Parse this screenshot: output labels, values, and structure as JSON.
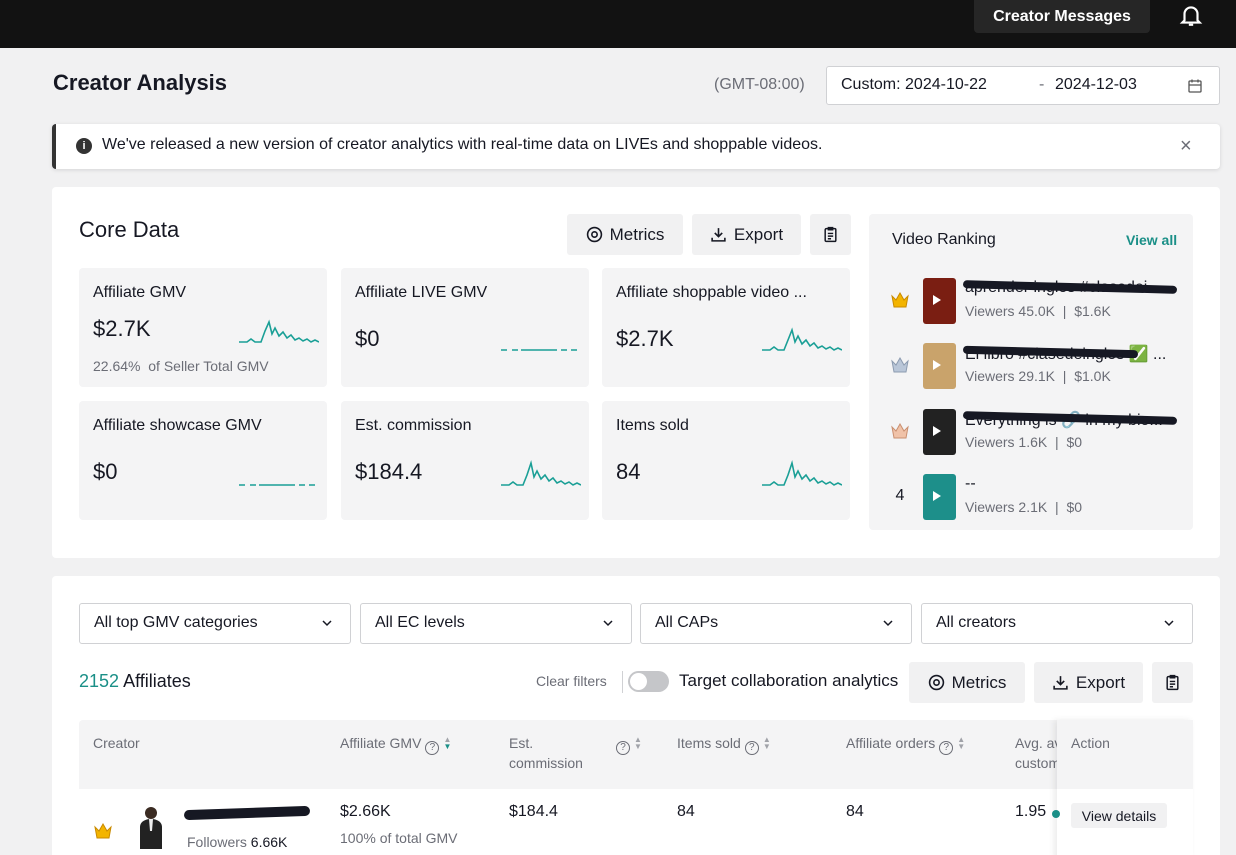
{
  "topbar": {
    "creator_messages": "Creator Messages"
  },
  "header": {
    "title": "Creator Analysis",
    "timezone": "(GMT-08:00)",
    "date_start": "Custom: 2024-10-22",
    "date_sep": "-",
    "date_end": "2024-12-03"
  },
  "banner": {
    "message": "We've released a new version of creator analytics with real-time data on LIVEs and shoppable videos.",
    "close": "×"
  },
  "core": {
    "title": "Core Data",
    "metrics_label": "Metrics",
    "export_label": "Export",
    "cards": [
      {
        "label": "Affiliate GMV",
        "value": "$2.7K",
        "sub_pct": "22.64%",
        "sub_text": "of Seller Total GMV",
        "trend": "spark"
      },
      {
        "label": "Affiliate LIVE GMV",
        "value": "$0",
        "trend": "flat"
      },
      {
        "label": "Affiliate shoppable video ...",
        "value": "$2.7K",
        "trend": "spark"
      },
      {
        "label": "Affiliate showcase GMV",
        "value": "$0",
        "trend": "flat"
      },
      {
        "label": "Est. commission",
        "value": "$184.4",
        "trend": "spark"
      },
      {
        "label": "Items sold",
        "value": "84",
        "trend": "spark"
      }
    ]
  },
  "video_ranking": {
    "title": "Video Ranking",
    "view_all": "View all",
    "items": [
      {
        "rank": "",
        "rank_icon": "gold-crown-icon",
        "title": "aprender ingles #clasedei...",
        "viewers": "Viewers 45.0K",
        "gmv": "$1.6K",
        "thumb_color": "#7a1e12"
      },
      {
        "rank": "",
        "rank_icon": "silver-crown-icon",
        "title": "El libro #clasedeingles ✅ ...",
        "viewers": "Viewers 29.1K",
        "gmv": "$1.0K",
        "thumb_color": "#c9a36b"
      },
      {
        "rank": "",
        "rank_icon": "bronze-crown-icon",
        "title": "Everything is 🔗 in my bio...",
        "viewers": "Viewers 1.6K",
        "gmv": "$0",
        "thumb_color": "#222222"
      },
      {
        "rank": "4",
        "rank_icon": "",
        "title": "--",
        "viewers": "Viewers 2.1K",
        "gmv": "$0",
        "thumb_color": "#1d8f8a"
      }
    ]
  },
  "filters": [
    "All top GMV categories",
    "All EC levels",
    "All CAPs",
    "All creators"
  ],
  "affiliates": {
    "count": "2152",
    "count_label": "Affiliates",
    "clear_filters": "Clear filters",
    "toggle_label": "Target collaboration analytics",
    "metrics_label": "Metrics",
    "export_label": "Export"
  },
  "table": {
    "headers": {
      "creator": "Creator",
      "gmv": "Affiliate GMV",
      "commission_1": "Est.",
      "commission_2": "commission",
      "items_sold": "Items sold",
      "orders": "Affiliate orders",
      "avg_1": "Avg. av",
      "avg_2": "custom",
      "action": "Action"
    },
    "row": {
      "followers_label": "Followers",
      "followers": "6.66K",
      "gmv": "$2.66K",
      "gmv_sub": "100% of total GMV",
      "commission": "$184.4",
      "items_sold": "84",
      "orders": "84",
      "avg": "1.95",
      "view_details": "View details"
    }
  },
  "colors": {
    "accent": "#1a8f87",
    "topbar": "#121212",
    "card_bg": "#f4f4f5"
  }
}
